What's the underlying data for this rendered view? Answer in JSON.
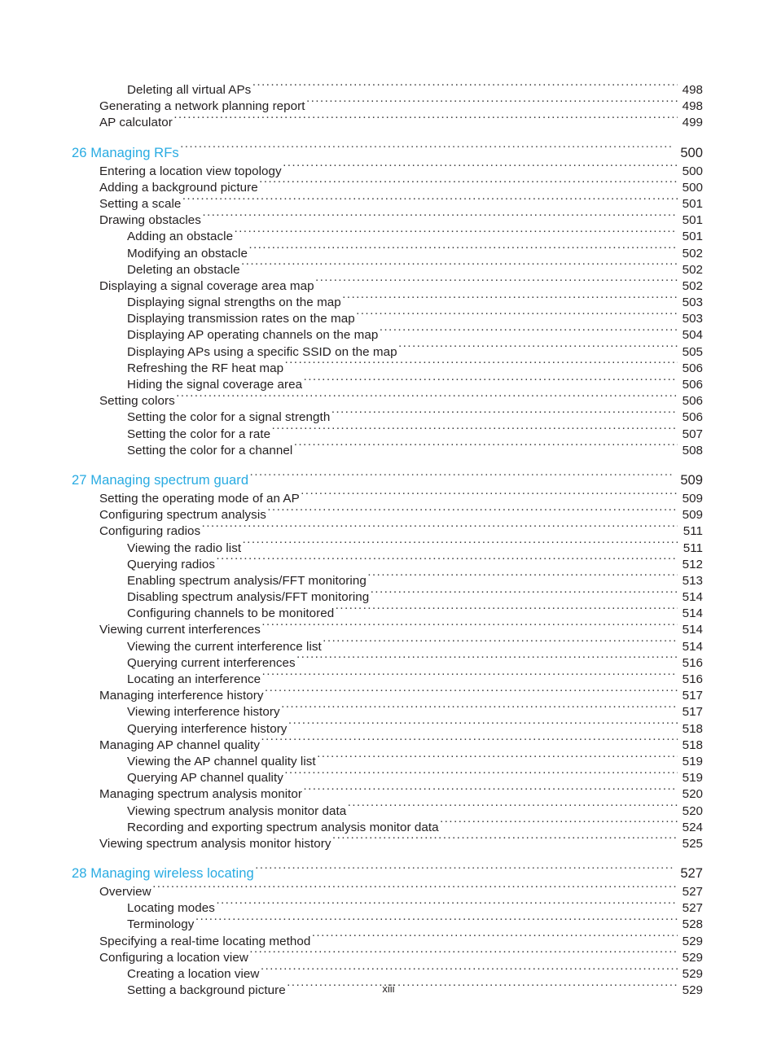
{
  "document": {
    "type": "table-of-contents",
    "footer_page_label": "xiii",
    "accent_color": "#29abe2",
    "text_color": "#231f20",
    "background_color": "#ffffff"
  },
  "entries": [
    {
      "label": "Deleting all virtual APs",
      "page": "498",
      "level": 2,
      "chapter": false
    },
    {
      "label": "Generating a network planning report",
      "page": "498",
      "level": 1,
      "chapter": false
    },
    {
      "label": "AP calculator",
      "page": "499",
      "level": 1,
      "chapter": false
    },
    {
      "label": "26 Managing RFs",
      "page": "500",
      "level": 0,
      "chapter": true
    },
    {
      "label": "Entering a location view topology",
      "page": "500",
      "level": 1,
      "chapter": false
    },
    {
      "label": "Adding a background picture",
      "page": "500",
      "level": 1,
      "chapter": false
    },
    {
      "label": "Setting a scale",
      "page": "501",
      "level": 1,
      "chapter": false
    },
    {
      "label": "Drawing obstacles",
      "page": "501",
      "level": 1,
      "chapter": false
    },
    {
      "label": "Adding an obstacle",
      "page": "501",
      "level": 2,
      "chapter": false
    },
    {
      "label": "Modifying an obstacle",
      "page": "502",
      "level": 2,
      "chapter": false
    },
    {
      "label": "Deleting an obstacle",
      "page": "502",
      "level": 2,
      "chapter": false
    },
    {
      "label": "Displaying a signal coverage area map",
      "page": "502",
      "level": 1,
      "chapter": false
    },
    {
      "label": "Displaying signal strengths on the map",
      "page": "503",
      "level": 2,
      "chapter": false
    },
    {
      "label": "Displaying transmission rates on the map",
      "page": "503",
      "level": 2,
      "chapter": false
    },
    {
      "label": "Displaying AP operating channels on the map",
      "page": "504",
      "level": 2,
      "chapter": false
    },
    {
      "label": "Displaying APs using a specific SSID on the map",
      "page": "505",
      "level": 2,
      "chapter": false
    },
    {
      "label": "Refreshing the RF heat map",
      "page": "506",
      "level": 2,
      "chapter": false
    },
    {
      "label": "Hiding the signal coverage area",
      "page": "506",
      "level": 2,
      "chapter": false
    },
    {
      "label": "Setting colors",
      "page": "506",
      "level": 1,
      "chapter": false
    },
    {
      "label": "Setting the color for a signal strength",
      "page": "506",
      "level": 2,
      "chapter": false
    },
    {
      "label": "Setting the color for a rate",
      "page": "507",
      "level": 2,
      "chapter": false
    },
    {
      "label": "Setting the color for a channel",
      "page": "508",
      "level": 2,
      "chapter": false
    },
    {
      "label": "27 Managing spectrum guard",
      "page": "509",
      "level": 0,
      "chapter": true
    },
    {
      "label": "Setting the operating mode of an AP",
      "page": "509",
      "level": 1,
      "chapter": false
    },
    {
      "label": "Configuring spectrum analysis",
      "page": "509",
      "level": 1,
      "chapter": false
    },
    {
      "label": "Configuring radios",
      "page": "511",
      "level": 1,
      "chapter": false
    },
    {
      "label": "Viewing the radio list",
      "page": "511",
      "level": 2,
      "chapter": false
    },
    {
      "label": "Querying radios",
      "page": "512",
      "level": 2,
      "chapter": false
    },
    {
      "label": "Enabling spectrum analysis/FFT monitoring",
      "page": "513",
      "level": 2,
      "chapter": false
    },
    {
      "label": "Disabling spectrum analysis/FFT monitoring",
      "page": "514",
      "level": 2,
      "chapter": false
    },
    {
      "label": "Configuring channels to be monitored",
      "page": "514",
      "level": 2,
      "chapter": false
    },
    {
      "label": "Viewing current interferences",
      "page": "514",
      "level": 1,
      "chapter": false
    },
    {
      "label": "Viewing the current interference list",
      "page": "514",
      "level": 2,
      "chapter": false
    },
    {
      "label": "Querying current interferences",
      "page": "516",
      "level": 2,
      "chapter": false
    },
    {
      "label": "Locating an interference",
      "page": "516",
      "level": 2,
      "chapter": false
    },
    {
      "label": "Managing interference history",
      "page": "517",
      "level": 1,
      "chapter": false
    },
    {
      "label": "Viewing interference history",
      "page": "517",
      "level": 2,
      "chapter": false
    },
    {
      "label": "Querying interference history",
      "page": "518",
      "level": 2,
      "chapter": false
    },
    {
      "label": "Managing AP channel quality",
      "page": "518",
      "level": 1,
      "chapter": false
    },
    {
      "label": "Viewing the AP channel quality list",
      "page": "519",
      "level": 2,
      "chapter": false
    },
    {
      "label": "Querying AP channel quality",
      "page": "519",
      "level": 2,
      "chapter": false
    },
    {
      "label": "Managing spectrum analysis monitor",
      "page": "520",
      "level": 1,
      "chapter": false
    },
    {
      "label": "Viewing spectrum analysis monitor data",
      "page": "520",
      "level": 2,
      "chapter": false
    },
    {
      "label": "Recording and exporting spectrum analysis monitor data",
      "page": "524",
      "level": 2,
      "chapter": false
    },
    {
      "label": "Viewing spectrum analysis monitor history",
      "page": "525",
      "level": 1,
      "chapter": false
    },
    {
      "label": "28 Managing wireless locating",
      "page": "527",
      "level": 0,
      "chapter": true
    },
    {
      "label": "Overview",
      "page": "527",
      "level": 1,
      "chapter": false
    },
    {
      "label": "Locating modes",
      "page": "527",
      "level": 2,
      "chapter": false
    },
    {
      "label": "Terminology",
      "page": "528",
      "level": 2,
      "chapter": false
    },
    {
      "label": "Specifying a real-time locating method",
      "page": "529",
      "level": 1,
      "chapter": false
    },
    {
      "label": "Configuring a location view",
      "page": "529",
      "level": 1,
      "chapter": false
    },
    {
      "label": "Creating a location view",
      "page": "529",
      "level": 2,
      "chapter": false
    },
    {
      "label": "Setting a background picture",
      "page": "529",
      "level": 2,
      "chapter": false
    }
  ]
}
